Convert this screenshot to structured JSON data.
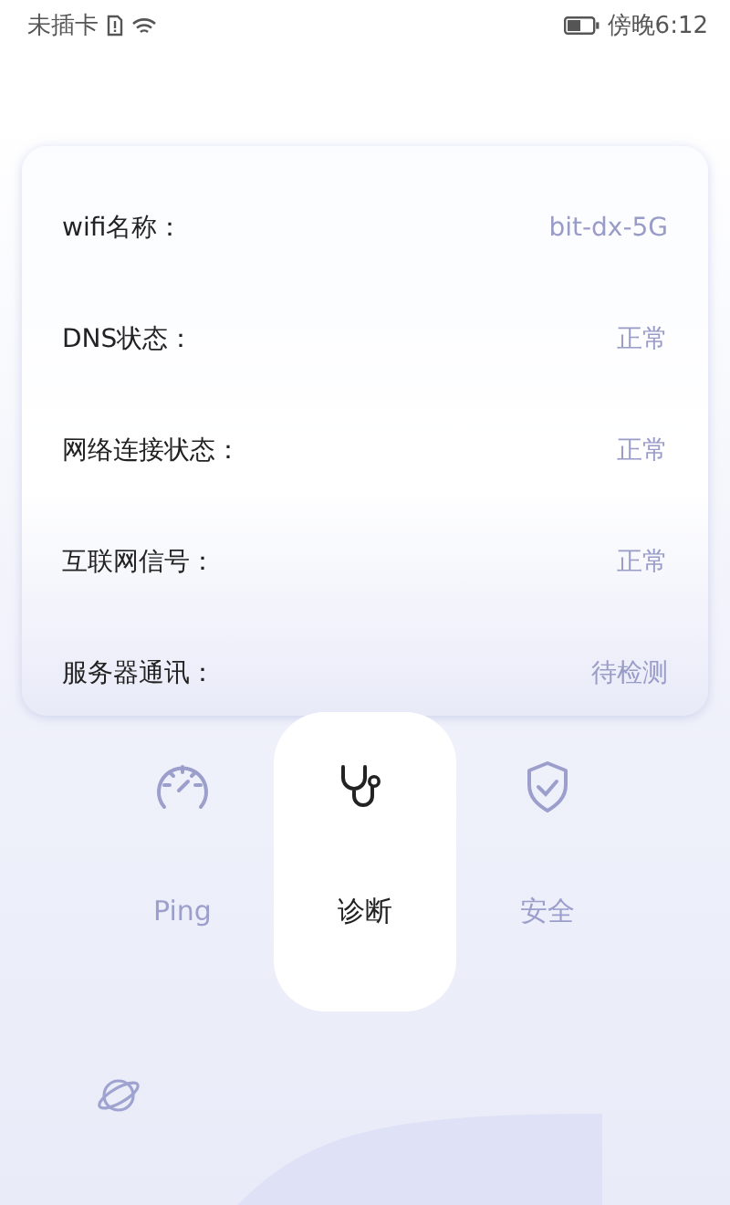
{
  "status_bar": {
    "carrier": "未插卡",
    "time": "傍晚6:12"
  },
  "info_rows": [
    {
      "label": "wifi名称：",
      "value": "bit-dx-5G"
    },
    {
      "label": "DNS状态：",
      "value": "正常"
    },
    {
      "label": "网络连接状态：",
      "value": "正常"
    },
    {
      "label": "互联网信号：",
      "value": "正常"
    },
    {
      "label": "服务器通讯：",
      "value": "待检测"
    }
  ],
  "tabs": [
    {
      "kind": "gauge",
      "label": "Ping",
      "selected": false
    },
    {
      "kind": "stethoscope",
      "label": "诊断",
      "selected": true
    },
    {
      "kind": "shield",
      "label": "安全",
      "selected": false
    }
  ]
}
